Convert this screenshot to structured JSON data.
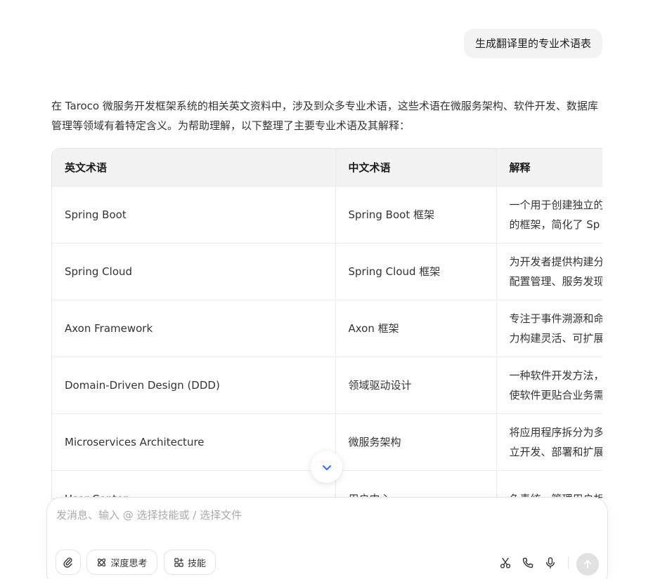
{
  "user_message": "生成翻译里的专业术语表",
  "answer_intro": "在 Taroco 微服务开发框架系统的相关英文资料中，涉及到众多专业术语，这些术语在微服务架构、软件开发、数据库管理等领域有着特定含义。为帮助理解，以下整理了主要专业术语及其解释：",
  "table": {
    "headers": [
      "英文术语",
      "中文术语",
      "解释"
    ],
    "rows": [
      {
        "en": "Spring Boot",
        "zh": "Spring Boot 框架",
        "explain1": "一个用于创建独立的",
        "explain2": "的框架，简化了 Sp"
      },
      {
        "en": "Spring Cloud",
        "zh": "Spring Cloud 框架",
        "explain1": "为开发者提供构建分",
        "explain2": "配置管理、服务发现"
      },
      {
        "en": "Axon Framework",
        "zh": "Axon 框架",
        "explain1": "专注于事件溯源和命",
        "explain2": "力构建灵活、可扩展"
      },
      {
        "en": "Domain-Driven Design (DDD)",
        "zh": "领域驱动设计",
        "explain1": "一种软件开发方法，",
        "explain2": "使软件更贴合业务需"
      },
      {
        "en": "Microservices Architecture",
        "zh": "微服务架构",
        "explain1": "将应用程序拆分为多",
        "explain2": "立开发、部署和扩展"
      },
      {
        "en": "User Center",
        "zh": "用户中心",
        "explain1": "负责统一管理用户相",
        "explain2": ""
      }
    ]
  },
  "composer": {
    "placeholder": "发消息、输入 @ 选择技能或 / 选择文件",
    "deep_think_label": "深度思考",
    "skills_label": "技能"
  },
  "icons": {
    "scroll_down": "chevron-down-icon",
    "attach": "paperclip-icon",
    "deep_think": "atom-icon",
    "skills": "grid-plus-icon",
    "scissors": "scissors-icon",
    "phone": "phone-icon",
    "mic": "microphone-icon",
    "send": "arrow-up-icon"
  },
  "colors": {
    "accent": "#2f6bff",
    "user_bubble_bg": "#f3f3f3",
    "table_header_bg": "#f2f2f2"
  }
}
